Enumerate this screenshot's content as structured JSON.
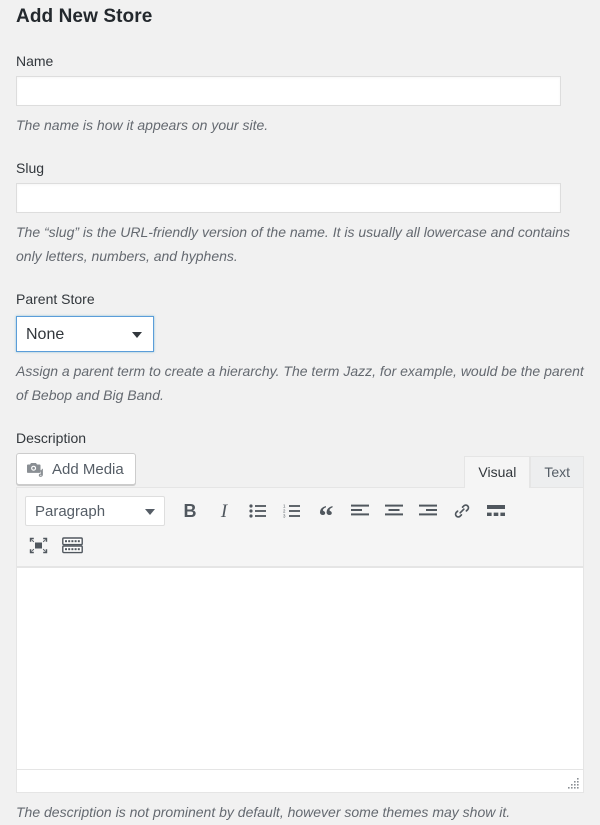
{
  "page": {
    "title": "Add New Store"
  },
  "fields": {
    "name": {
      "label": "Name",
      "value": "",
      "placeholder": "",
      "description": "The name is how it appears on your site."
    },
    "slug": {
      "label": "Slug",
      "value": "",
      "placeholder": "",
      "description": "The “slug” is the URL-friendly version of the name. It is usually all lowercase and contains only letters, numbers, and hyphens."
    },
    "parent_store": {
      "label": "Parent Store",
      "selected": "None",
      "options": [
        "None"
      ],
      "description": "Assign a parent term to create a hierarchy. The term Jazz, for example, would be the parent of Bebop and Big Band."
    },
    "description": {
      "label": "Description",
      "value": "",
      "description": "The description is not prominent by default, however some themes may show it."
    }
  },
  "editor": {
    "add_media_label": "Add Media",
    "add_media_icon": "camera-music-icon",
    "tabs": [
      {
        "label": "Visual",
        "active": true
      },
      {
        "label": "Text",
        "active": false
      }
    ],
    "toolbar": {
      "format_select": {
        "selected": "Paragraph",
        "options": [
          "Paragraph"
        ]
      },
      "row1": [
        {
          "name": "bold-icon",
          "label": "B"
        },
        {
          "name": "italic-icon",
          "label": "I"
        },
        {
          "name": "bulleted-list-icon",
          "label": ""
        },
        {
          "name": "numbered-list-icon",
          "label": ""
        },
        {
          "name": "blockquote-icon",
          "label": "“"
        },
        {
          "name": "align-left-icon",
          "label": ""
        },
        {
          "name": "align-center-icon",
          "label": ""
        },
        {
          "name": "align-right-icon",
          "label": ""
        },
        {
          "name": "insert-link-icon",
          "label": ""
        },
        {
          "name": "read-more-icon",
          "label": ""
        }
      ],
      "row2": [
        {
          "name": "fullscreen-icon",
          "label": ""
        },
        {
          "name": "toolbar-toggle-icon",
          "label": ""
        }
      ]
    },
    "content": "",
    "resize_handle": "resize-grip-icon"
  },
  "colors": {
    "page_background": "#f1f1f1",
    "input_background": "#ffffff",
    "input_border": "#dddddd",
    "select_focus_border": "#5b9dd9",
    "toolbar_background": "#f5f5f5",
    "icon_color": "#50575e",
    "text_color": "#32373c",
    "description_color": "#646970"
  }
}
